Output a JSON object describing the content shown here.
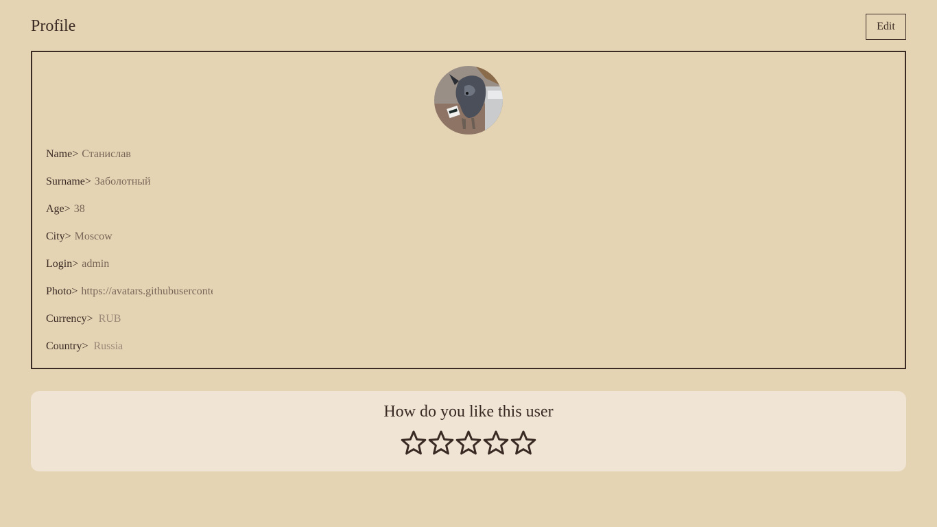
{
  "header": {
    "title": "Profile",
    "edit_label": "Edit"
  },
  "profile": {
    "avatar_icon": "user-photo-dog",
    "fields": [
      {
        "label": "Name>",
        "value": "Станислав"
      },
      {
        "label": "Surname>",
        "value": "Заболотный"
      },
      {
        "label": "Age>",
        "value": "38"
      },
      {
        "label": "City>",
        "value": "Moscow"
      },
      {
        "label": "Login>",
        "value": "admin"
      },
      {
        "label": "Photo>",
        "value": "https://avatars.githubusercontent.com"
      },
      {
        "label": "Currency>",
        "value": "RUB"
      },
      {
        "label": "Country>",
        "value": "Russia"
      }
    ]
  },
  "rating": {
    "title": "How do you like this user",
    "max_stars": 5,
    "selected": 0,
    "star_icon": "star-outline-icon"
  },
  "colors": {
    "background": "#e5d4b3",
    "text": "#3a2a24",
    "value_text": "#7a6658",
    "rating_panel": "#f0e4d4"
  }
}
